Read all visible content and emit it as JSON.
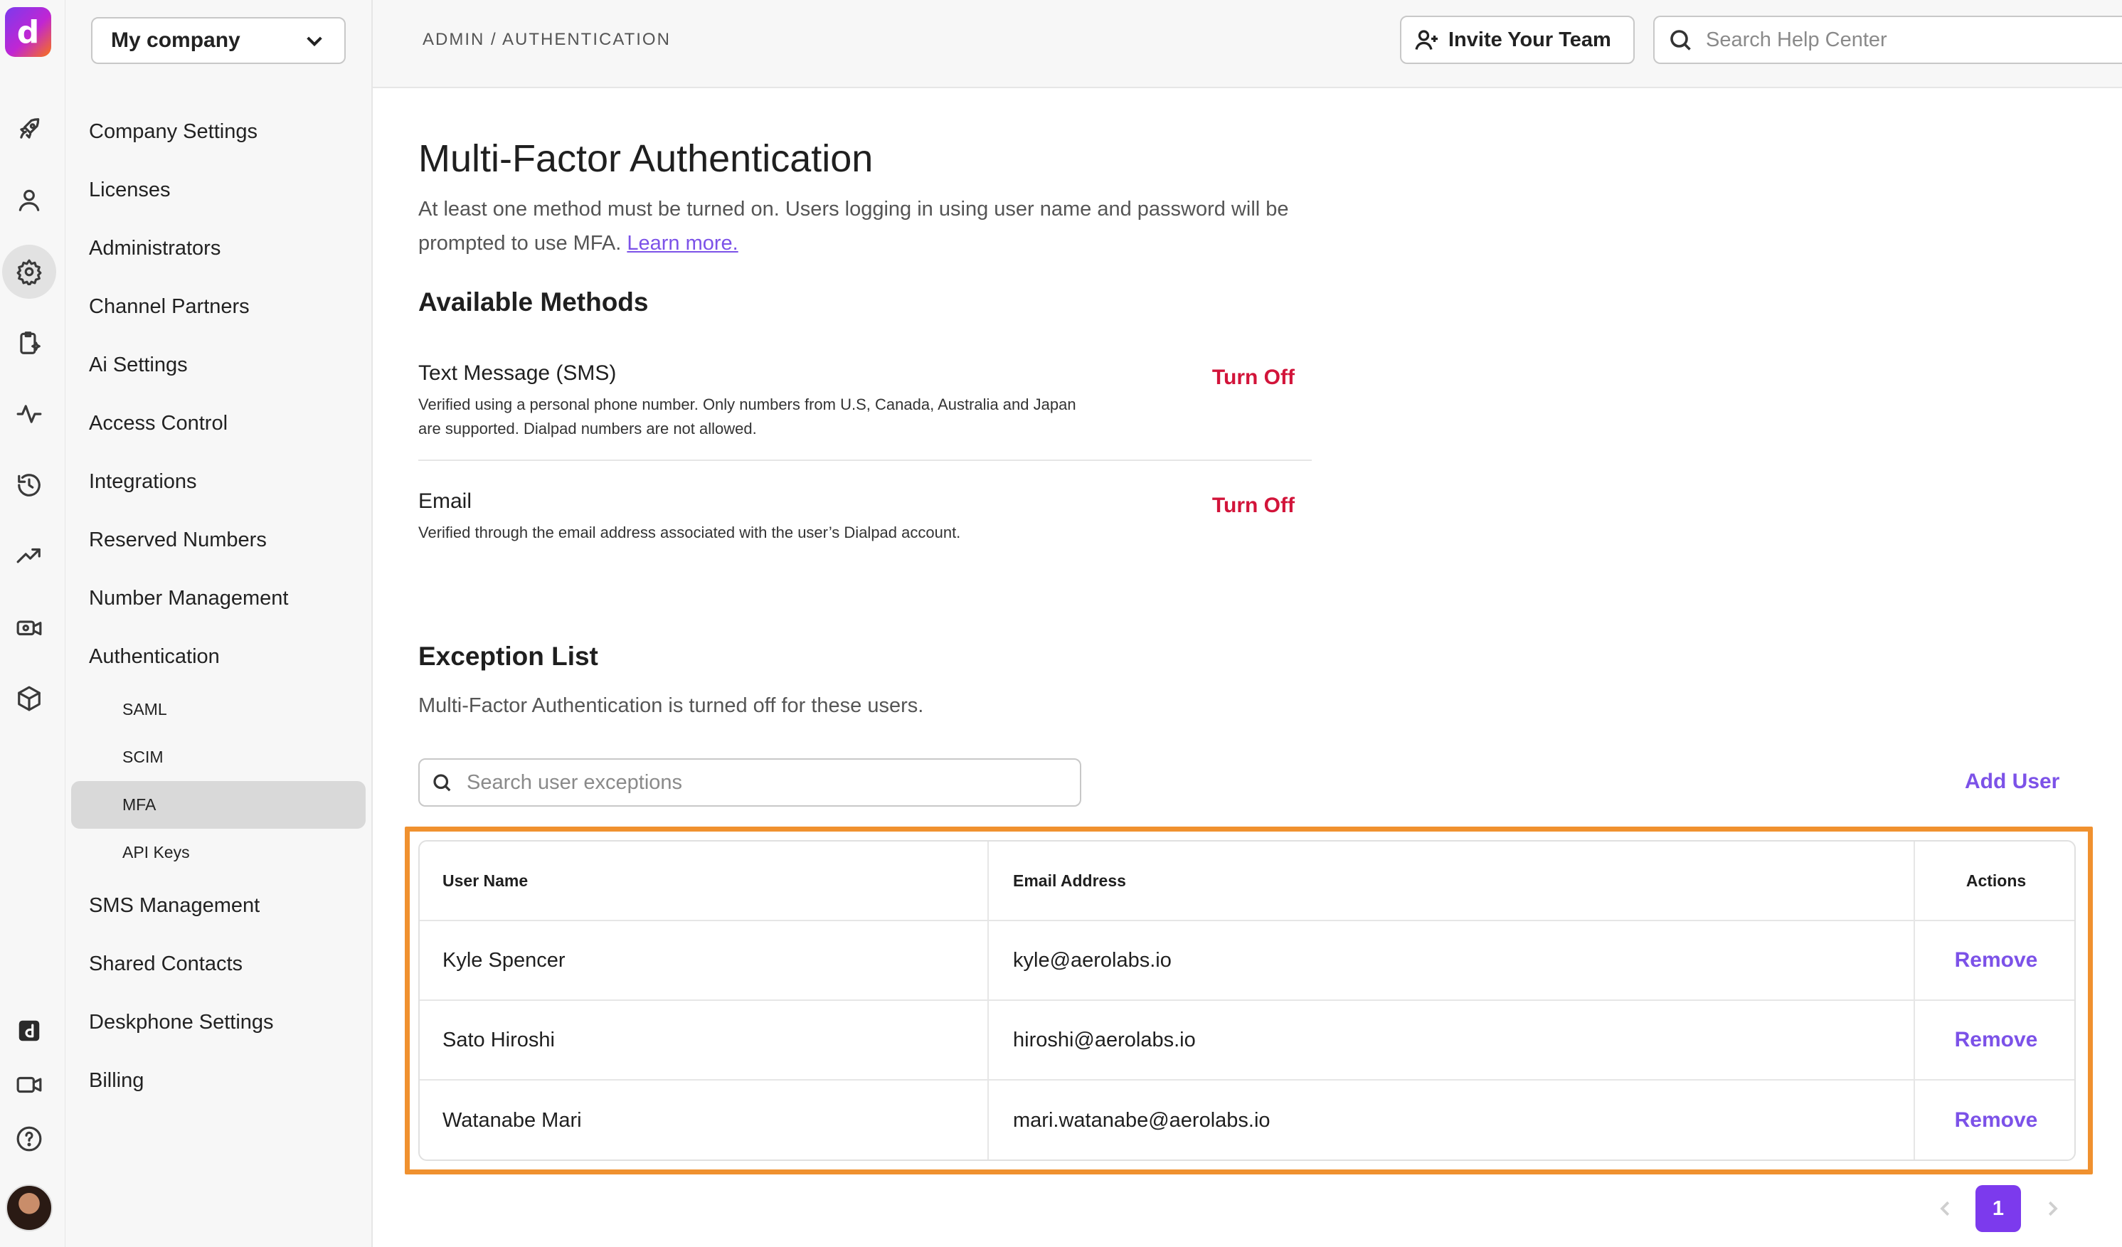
{
  "rail": {
    "logo_glyph": "d",
    "icons": [
      "rocket-icon",
      "user-icon",
      "gear-icon",
      "clipboard-sparkle-icon",
      "activity-icon",
      "history-icon",
      "trending-up-icon",
      "video-ai-icon",
      "cube-icon",
      "dialpad-app-icon",
      "video-camera-icon",
      "help-icon"
    ]
  },
  "sidebar": {
    "company": "My company",
    "items": [
      {
        "label": "Company Settings"
      },
      {
        "label": "Licenses"
      },
      {
        "label": "Administrators"
      },
      {
        "label": "Channel Partners"
      },
      {
        "label": "Ai Settings"
      },
      {
        "label": "Access Control"
      },
      {
        "label": "Integrations"
      },
      {
        "label": "Reserved Numbers"
      },
      {
        "label": "Number Management"
      },
      {
        "label": "Authentication"
      }
    ],
    "sub_items": [
      {
        "label": "SAML"
      },
      {
        "label": "SCIM"
      },
      {
        "label": "MFA"
      },
      {
        "label": "API Keys"
      }
    ],
    "items_after": [
      {
        "label": "SMS Management"
      },
      {
        "label": "Shared Contacts"
      },
      {
        "label": "Deskphone Settings"
      },
      {
        "label": "Billing"
      }
    ]
  },
  "topbar": {
    "breadcrumb": "ADMIN / AUTHENTICATION",
    "invite_label": "Invite Your Team",
    "search_placeholder": "Search Help Center"
  },
  "page": {
    "title": "Multi-Factor Authentication",
    "intro": "At least one method must be turned on. Users logging in using user name and password will be prompted to use MFA.",
    "learn_more": "Learn more.",
    "available_heading": "Available Methods",
    "methods": [
      {
        "title": "Text Message (SMS)",
        "description": "Verified using a personal phone number. Only numbers from U.S, Canada, Australia and Japan are supported. Dialpad numbers are not allowed.",
        "action": "Turn Off"
      },
      {
        "title": "Email",
        "description": "Verified through the email address associated with the user’s Dialpad account.",
        "action": "Turn Off"
      }
    ],
    "exception_heading": "Exception List",
    "exception_desc": "Multi-Factor Authentication is turned off for these users.",
    "exception_search_placeholder": "Search user exceptions",
    "add_user": "Add User"
  },
  "table": {
    "headers": [
      "User Name",
      "Email Address",
      "Actions"
    ],
    "rows": [
      {
        "name": "Kyle Spencer",
        "email": "kyle@aerolabs.io",
        "action": "Remove"
      },
      {
        "name": "Sato Hiroshi",
        "email": "hiroshi@aerolabs.io",
        "action": "Remove"
      },
      {
        "name": "Watanabe Mari",
        "email": "mari.watanabe@aerolabs.io",
        "action": "Remove"
      }
    ]
  },
  "pagination": {
    "current": "1"
  },
  "colors": {
    "accent": "#7c3aed",
    "link": "#7c52e8",
    "danger": "#d2143a",
    "highlight": "#f0912f"
  }
}
